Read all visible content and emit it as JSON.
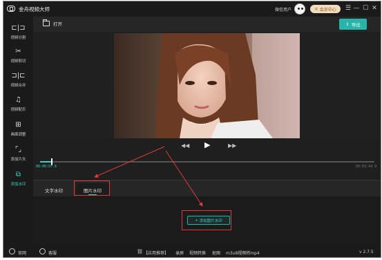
{
  "app": {
    "title": "金舟视频大师"
  },
  "header": {
    "user_label": "微信用户",
    "vip_label": "会员中心",
    "vip_icon": "crown-icon",
    "vip_color": "#f2dcbc"
  },
  "window_controls": [
    {
      "name": "menu-button",
      "glyph": "☰"
    },
    {
      "name": "minimize-button",
      "glyph": "—"
    },
    {
      "name": "maximize-button",
      "glyph": "☐"
    },
    {
      "name": "close-button",
      "glyph": "✕"
    }
  ],
  "sidebar": {
    "items": [
      {
        "label": "视频分割",
        "icon": "split-icon",
        "glyph": "⊏|⊐"
      },
      {
        "label": "视频剪切",
        "icon": "scissors-icon",
        "glyph": "✂"
      },
      {
        "label": "视频合并",
        "icon": "merge-icon",
        "glyph": "⊐|⊏"
      },
      {
        "label": "视频配乐",
        "icon": "music-icon",
        "glyph": "♫"
      },
      {
        "label": "画面调整",
        "icon": "adjust-icon",
        "glyph": "⊞"
      },
      {
        "label": "添加片头",
        "icon": "intro-icon",
        "glyph": "⌜⌟"
      },
      {
        "label": "添加水印",
        "icon": "watermark-icon",
        "glyph": "⧉"
      }
    ],
    "active_index": 6,
    "accent_color": "#3ed0c6"
  },
  "toolbar": {
    "open_label": "打开",
    "export_label": "导出",
    "export_color": "#27b5a9"
  },
  "player": {
    "prev_icon": "rewind-icon",
    "play_icon": "play-icon",
    "next_icon": "fast-forward-icon",
    "current_time": "00:00:07.6",
    "total_time": "00:03:44.9",
    "progress": 0.034
  },
  "tabs": [
    {
      "label": "文字水印"
    },
    {
      "label": "图片水印"
    }
  ],
  "active_tab": 1,
  "panel": {
    "add_button": "添加图片水印"
  },
  "statusbar": {
    "website": "官网",
    "support": "客服",
    "links_icon": "link-icon",
    "links": [
      "【应用推荐】",
      "录屏",
      "视频转换",
      "抠图",
      "m3u8视频转mp4"
    ],
    "version": "v 2.7.5"
  },
  "annotation_color": "#e03a3a"
}
